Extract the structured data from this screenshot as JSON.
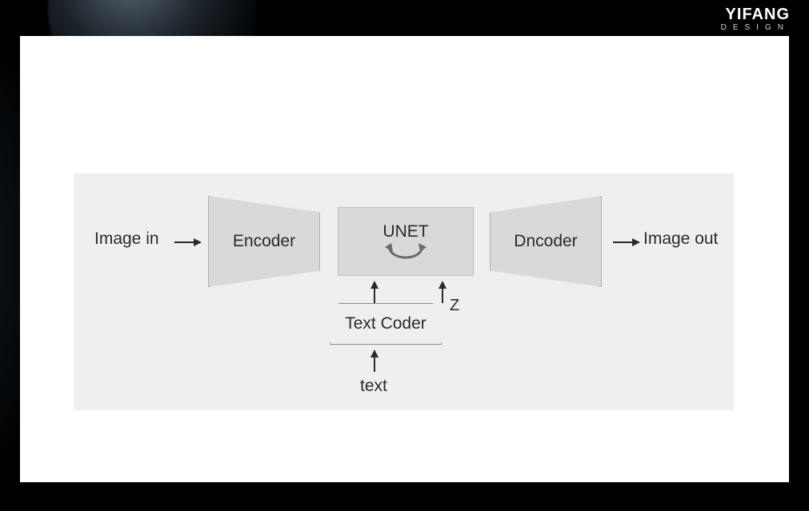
{
  "brand": {
    "title": "YIFANG",
    "subtitle": "DESIGN"
  },
  "diagram": {
    "image_in": "Image in",
    "encoder": "Encoder",
    "unet": "UNET",
    "decoder": "Dncoder",
    "image_out": "Image out",
    "z": "Z",
    "text_coder": "Text Coder",
    "text": "text"
  }
}
